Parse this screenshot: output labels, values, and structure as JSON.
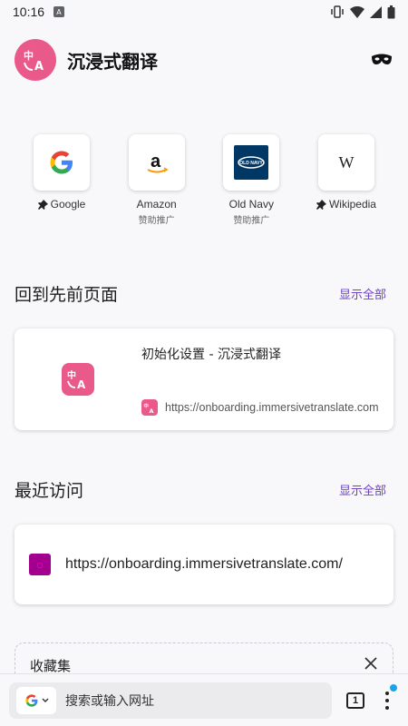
{
  "status_bar": {
    "time": "10:16"
  },
  "header": {
    "app_title": "沉浸式翻译"
  },
  "shortcuts": [
    {
      "label": "Google",
      "pinned": true,
      "sub": ""
    },
    {
      "label": "Amazon",
      "pinned": false,
      "sub": "赞助推广"
    },
    {
      "label": "Old Navy",
      "pinned": false,
      "sub": "赞助推广"
    },
    {
      "label": "Wikipedia",
      "pinned": true,
      "sub": ""
    }
  ],
  "recent_pages": {
    "title": "回到先前页面",
    "show_all": "显示全部",
    "card": {
      "title": "初始化设置 - 沉浸式翻译",
      "url": "https://onboarding.immersivetranslate.com"
    }
  },
  "recently_visited": {
    "title": "最近访问",
    "show_all": "显示全部",
    "item": {
      "url": "https://onboarding.immersivetranslate.com/"
    }
  },
  "collections": {
    "title": "收藏集"
  },
  "toolbar": {
    "search_placeholder": "搜索或输入网址",
    "tab_count": "1"
  },
  "icons": {
    "logo": "immersive-translate-logo",
    "private_mode": "mask-icon",
    "close": "close-icon",
    "menu": "more-vert-icon"
  },
  "colors": {
    "accent": "#6d3ec8",
    "brand_pink": "#e95a8b",
    "notification_dot": "#1aa3e8"
  }
}
